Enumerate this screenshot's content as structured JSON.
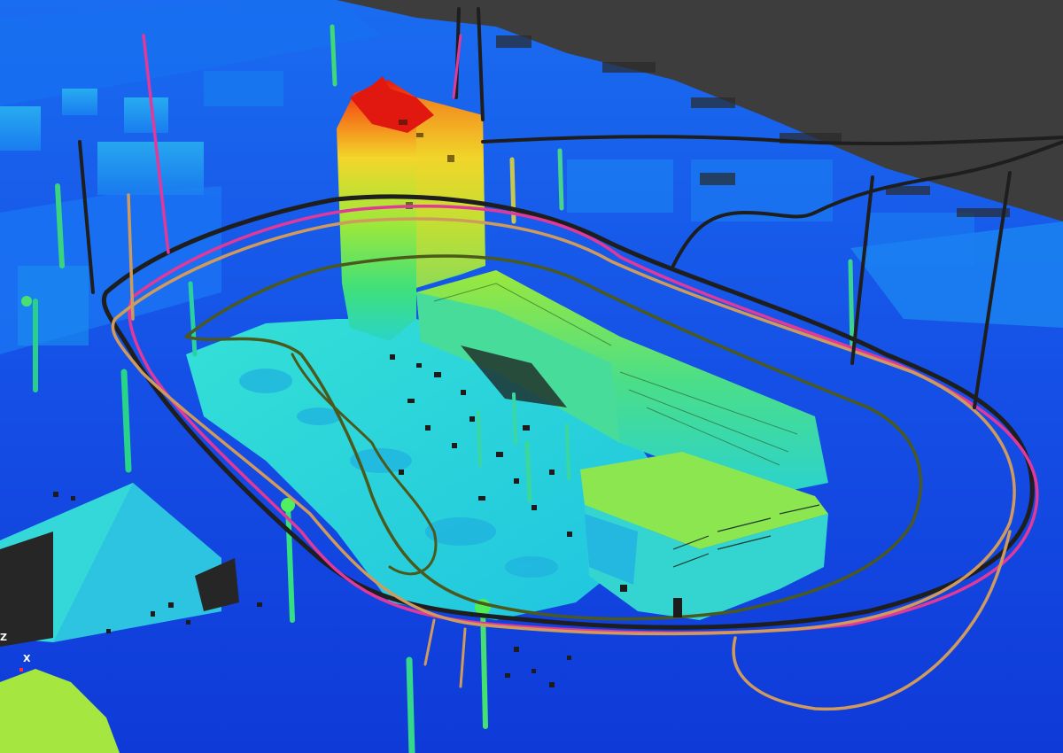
{
  "viewer": {
    "background_color": "#3d3d3d",
    "colormap": [
      "#0b2fd8",
      "#1060ff",
      "#18b4f0",
      "#2ee6d2",
      "#5cf0a0",
      "#b8f03a",
      "#f0e62a",
      "#f59a1c",
      "#e61a10"
    ],
    "scene_description_colors": {
      "ground": "#1448e0",
      "structure_low": "#28d8d8",
      "structure_mid": "#8cec3c",
      "structure_high": "#e8160c",
      "gap_dark": "#1a1a1a"
    },
    "trajectories": [
      {
        "name": "trajectory-black",
        "color": "#1e1e1e"
      },
      {
        "name": "trajectory-magenta",
        "color": "#e0399a"
      },
      {
        "name": "trajectory-tan",
        "color": "#d09a5c"
      },
      {
        "name": "trajectory-olive",
        "color": "#4b5a1c"
      }
    ]
  },
  "axis_widget": {
    "labels": [
      "Z",
      "X"
    ],
    "colors": {
      "x": "#ff3030",
      "y": "#30ff30",
      "z": "#3060ff"
    }
  }
}
